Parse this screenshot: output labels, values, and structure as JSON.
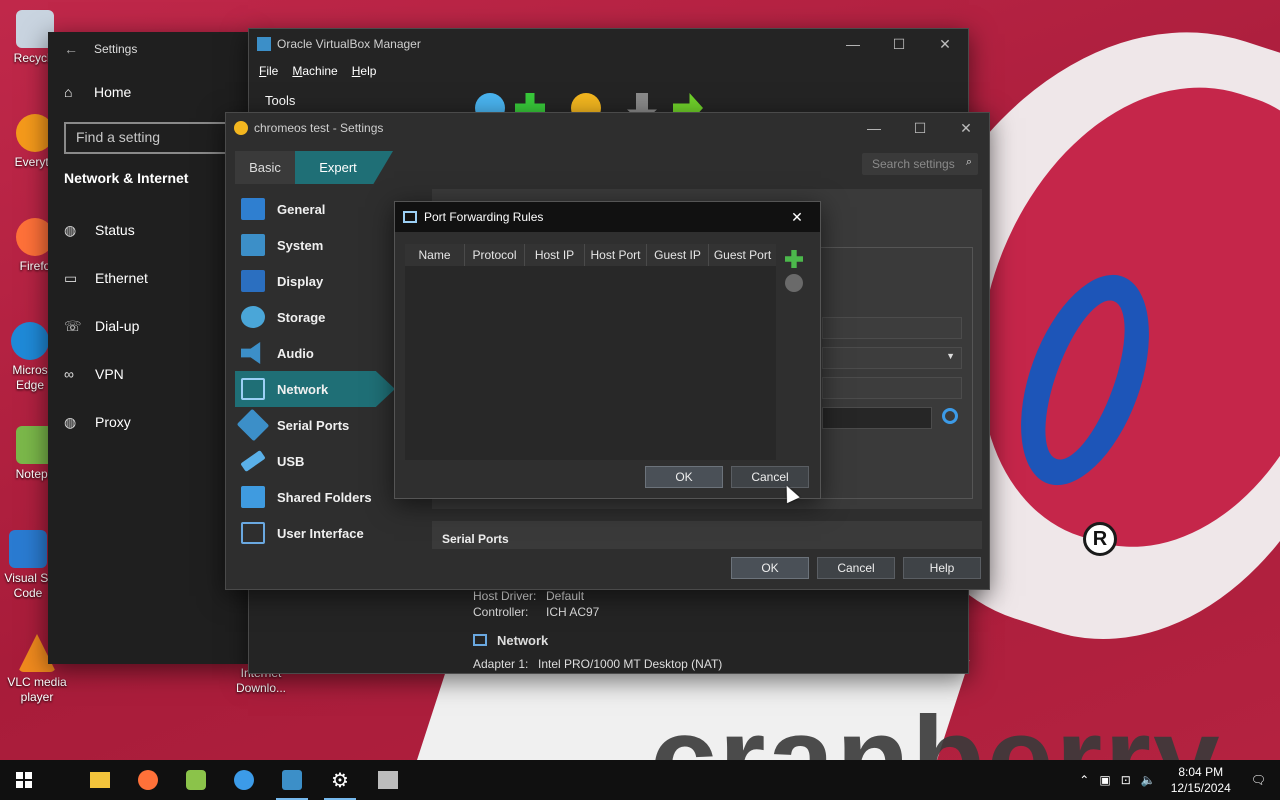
{
  "desktop": {
    "icons": [
      {
        "label": "Recycle",
        "color": "#c9d4e0"
      },
      {
        "label": "Everyth",
        "color": "#f59a1b"
      },
      {
        "label": "Firefo",
        "color": "#ff7139"
      },
      {
        "label": "Micros Edge",
        "color": "#1f8ad8"
      },
      {
        "label": "Notepa",
        "color": "#7bb84a"
      },
      {
        "label": "Visual St Code",
        "color": "#2a7bd1"
      },
      {
        "label": "VLC media player",
        "color": "#f08a1e"
      },
      {
        "label": "Internet Downlo...",
        "color": "#3d8fd8"
      }
    ],
    "wallpaper_text": "cranberry",
    "wallpaper_mark": "R"
  },
  "win_settings": {
    "title": "Settings",
    "home": "Home",
    "search_placeholder": "Find a setting",
    "section": "Network & Internet",
    "items": [
      "Status",
      "Ethernet",
      "Dial-up",
      "VPN",
      "Proxy"
    ]
  },
  "vbox_manager": {
    "title": "Oracle VirtualBox Manager",
    "menu": [
      "File",
      "Machine",
      "Help"
    ],
    "tools_label": "Tools",
    "details": {
      "host_driver_key": "Host Driver:",
      "host_driver_val": "Default",
      "controller_key": "Controller:",
      "controller_val": "ICH AC97",
      "network_header": "Network",
      "adapter_key": "Adapter 1:",
      "adapter_val": "Intel PRO/1000 MT Desktop (NAT)"
    }
  },
  "vm_settings": {
    "title": "chromeos test - Settings",
    "tabs": [
      "Basic",
      "Expert"
    ],
    "active_tab": "Expert",
    "search_placeholder": "Search settings",
    "nav": [
      "General",
      "System",
      "Display",
      "Storage",
      "Audio",
      "Network",
      "Serial Ports",
      "USB",
      "Shared Folders",
      "User Interface"
    ],
    "active_nav": "Network",
    "serial_ports_header": "Serial Ports",
    "buttons": {
      "ok": "OK",
      "cancel": "Cancel",
      "help": "Help"
    }
  },
  "port_forwarding": {
    "title": "Port Forwarding Rules",
    "columns": [
      "Name",
      "Protocol",
      "Host IP",
      "Host Port",
      "Guest IP",
      "Guest Port"
    ],
    "rows": [],
    "buttons": {
      "ok": "OK",
      "cancel": "Cancel"
    }
  },
  "taskbar": {
    "time": "8:04 PM",
    "date": "12/15/2024"
  },
  "colors": {
    "accent_teal": "#1f6f76",
    "wallpaper_red": "#b7213f",
    "brand_blue": "#1d55b8"
  }
}
